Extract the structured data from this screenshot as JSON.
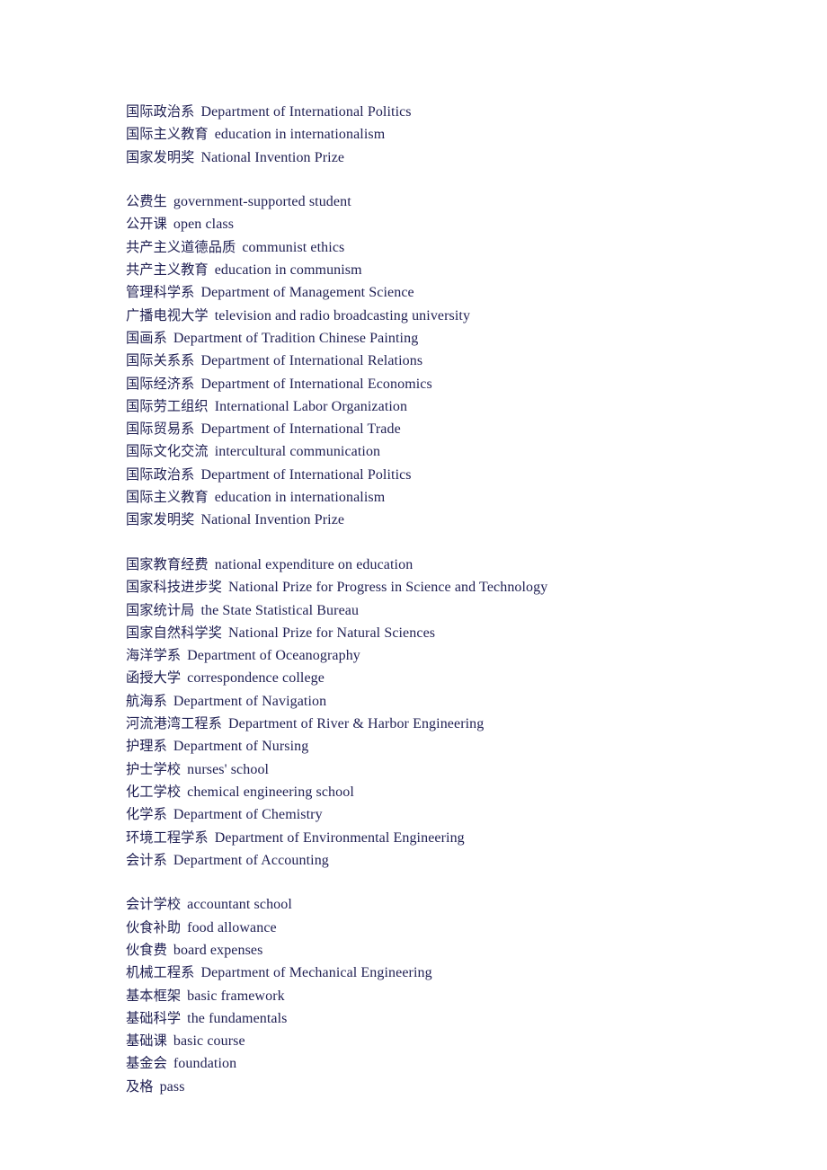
{
  "document": {
    "type": "chinese-english-glossary",
    "text_color": "#1f1f52",
    "background_color": "#ffffff",
    "blocks": [
      {
        "entries": [
          {
            "term": "国际政治系",
            "gloss": "Department of International Politics"
          },
          {
            "term": "国际主义教育",
            "gloss": "education in internationalism"
          },
          {
            "term": "国家发明奖",
            "gloss": "National Invention Prize"
          }
        ]
      },
      {
        "entries": [
          {
            "term": "公费生",
            "gloss": "government-supported student"
          },
          {
            "term": "公开课",
            "gloss": "open class"
          },
          {
            "term": "共产主义道德品质",
            "gloss": "communist ethics"
          },
          {
            "term": "共产主义教育",
            "gloss": "education in communism"
          },
          {
            "term": "管理科学系",
            "gloss": "Department of Management Science"
          },
          {
            "term": "广播电视大学",
            "gloss": "television and radio broadcasting university"
          },
          {
            "term": "国画系",
            "gloss": "Department of Tradition Chinese Painting"
          },
          {
            "term": "国际关系系",
            "gloss": "Department of International Relations"
          },
          {
            "term": "国际经济系",
            "gloss": "Department of International Economics"
          },
          {
            "term": "国际劳工组织",
            "gloss": "International Labor Organization"
          },
          {
            "term": "国际贸易系",
            "gloss": "Department of International Trade"
          },
          {
            "term": "国际文化交流",
            "gloss": "intercultural communication"
          },
          {
            "term": "国际政治系",
            "gloss": "Department of International Politics"
          },
          {
            "term": "国际主义教育",
            "gloss": "education in internationalism"
          },
          {
            "term": "国家发明奖",
            "gloss": "National Invention Prize"
          }
        ]
      },
      {
        "entries": [
          {
            "term": "国家教育经费",
            "gloss": "national expenditure on education"
          },
          {
            "term": "国家科技进步奖",
            "gloss": "National Prize for Progress in Science and Technology"
          },
          {
            "term": "国家统计局",
            "gloss": "the State Statistical Bureau"
          },
          {
            "term": "国家自然科学奖",
            "gloss": "National Prize for Natural Sciences"
          },
          {
            "term": "海洋学系",
            "gloss": "Department of Oceanography"
          },
          {
            "term": "函授大学",
            "gloss": "correspondence college"
          },
          {
            "term": "航海系",
            "gloss": "Department of Navigation"
          },
          {
            "term": "河流港湾工程系",
            "gloss": "Department of River & Harbor Engineering"
          },
          {
            "term": "护理系",
            "gloss": "Department of Nursing"
          },
          {
            "term": "护士学校",
            "gloss": "nurses' school"
          },
          {
            "term": "化工学校",
            "gloss": "chemical engineering school"
          },
          {
            "term": "化学系",
            "gloss": "Department of Chemistry"
          },
          {
            "term": "环境工程学系",
            "gloss": "Department of Environmental Engineering"
          },
          {
            "term": "会计系",
            "gloss": "Department of Accounting"
          }
        ]
      },
      {
        "entries": [
          {
            "term": "会计学校",
            "gloss": "accountant school"
          },
          {
            "term": "伙食补助",
            "gloss": "food allowance"
          },
          {
            "term": "伙食费",
            "gloss": "board expenses"
          },
          {
            "term": "机械工程系",
            "gloss": "Department of Mechanical Engineering"
          },
          {
            "term": "基本框架",
            "gloss": "basic framework"
          },
          {
            "term": "基础科学",
            "gloss": "the fundamentals"
          },
          {
            "term": "基础课",
            "gloss": "basic course"
          },
          {
            "term": "基金会",
            "gloss": "foundation"
          },
          {
            "term": "及格",
            "gloss": "pass"
          }
        ]
      }
    ]
  }
}
